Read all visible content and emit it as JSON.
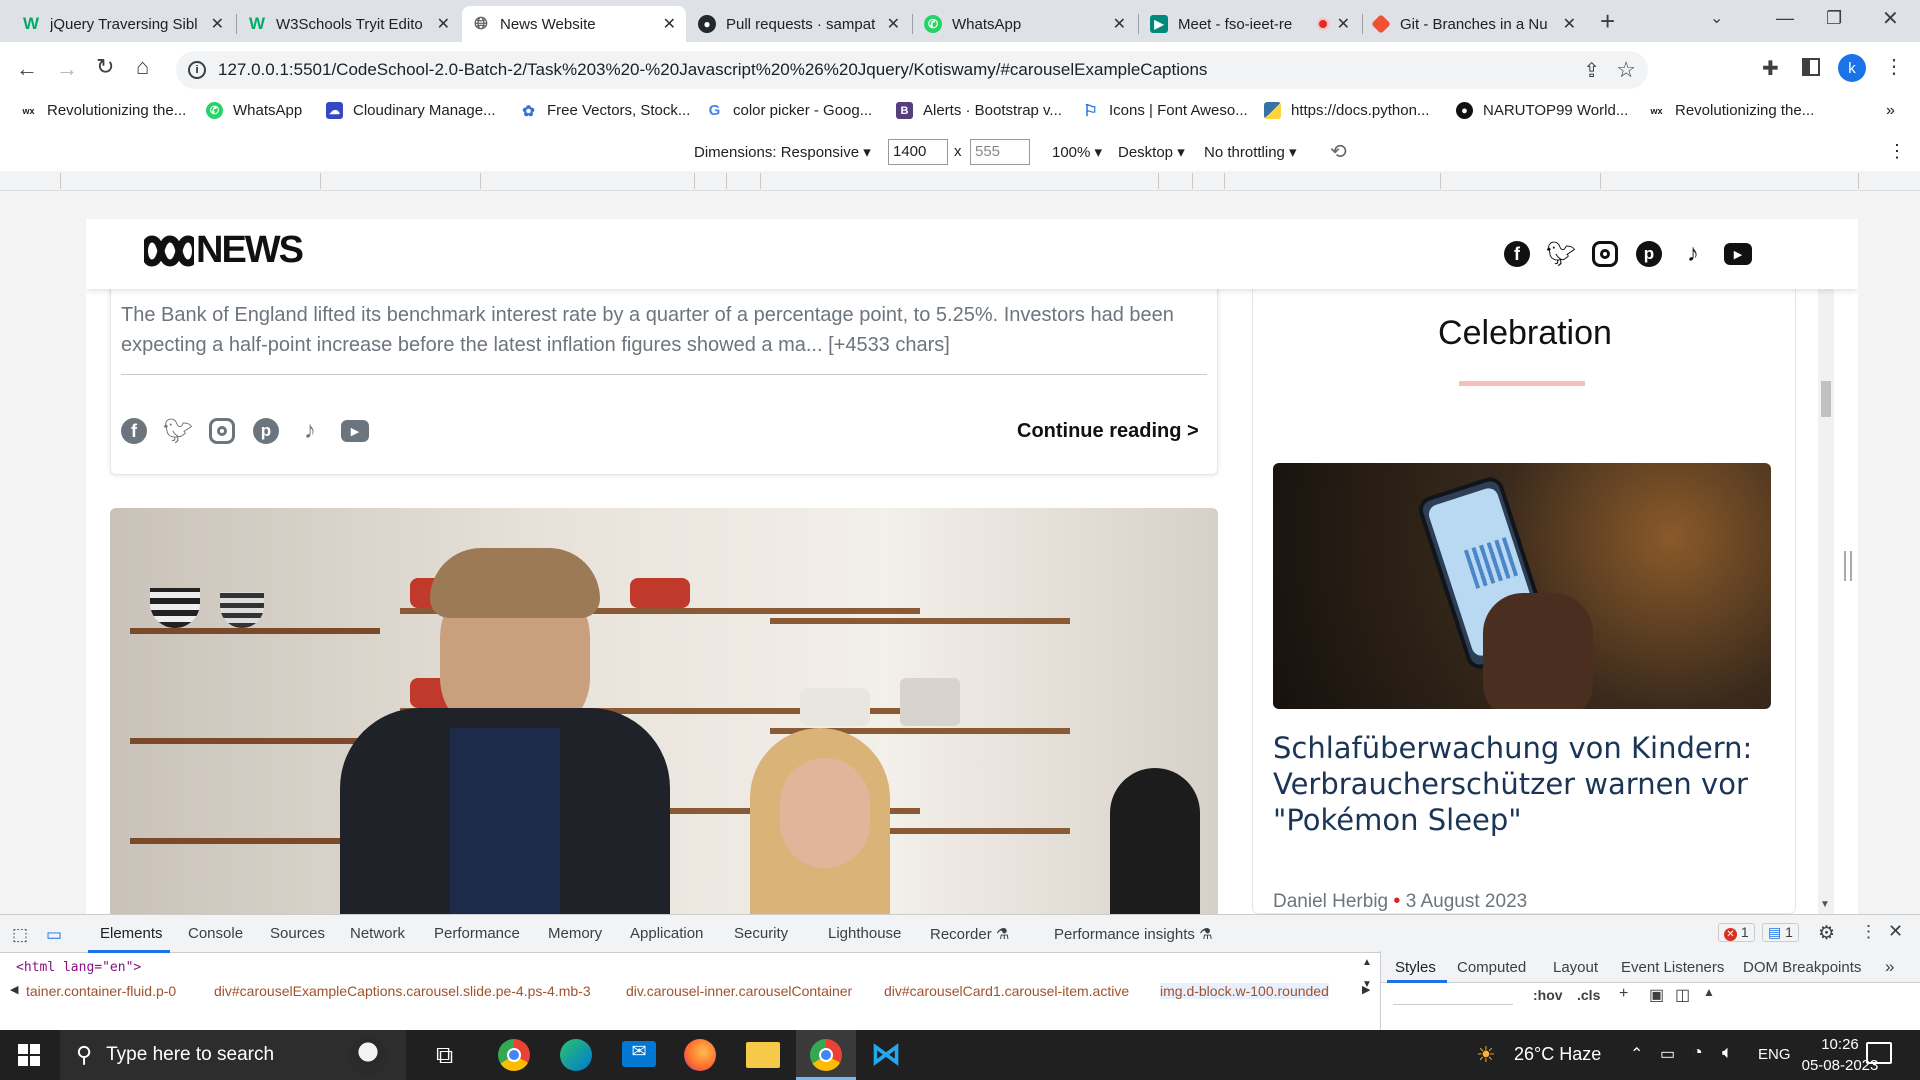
{
  "tabs": [
    {
      "title": "jQuery Traversing Sibl",
      "favicon": "w3schools-icon",
      "active": false
    },
    {
      "title": "W3Schools Tryit Edito",
      "favicon": "w3schools-icon",
      "active": false
    },
    {
      "title": "News Website",
      "favicon": "globe-icon",
      "active": true
    },
    {
      "title": "Pull requests · sampat",
      "favicon": "github-icon",
      "active": false
    },
    {
      "title": "WhatsApp",
      "favicon": "whatsapp-icon",
      "active": false
    },
    {
      "title": "Meet - fso-ieet-re",
      "favicon": "meet-icon",
      "active": false
    },
    {
      "title": "Git - Branches in a Nu",
      "favicon": "git-icon",
      "active": false
    }
  ],
  "address": {
    "url": "127.0.0.1:5501/CodeSchool-2.0-Batch-2/Task%203%20-%20Javascript%20%26%20Jquery/Kotiswamy/#carouselExampleCaptions",
    "profile_initial": "k"
  },
  "bookmarks": [
    {
      "label": "Revolutionizing the...",
      "icon": "wix-icon"
    },
    {
      "label": "WhatsApp",
      "icon": "whatsapp-icon"
    },
    {
      "label": "Cloudinary Manage...",
      "icon": "cloudinary-icon"
    },
    {
      "label": "Free Vectors, Stock...",
      "icon": "vecteezy-icon"
    },
    {
      "label": "color picker - Goog...",
      "icon": "google-icon"
    },
    {
      "label": "Alerts · Bootstrap v...",
      "icon": "bootstrap-icon"
    },
    {
      "label": "Icons | Font Aweso...",
      "icon": "flag-icon"
    },
    {
      "label": "https://docs.python...",
      "icon": "python-icon"
    },
    {
      "label": "NARUTOP99 World...",
      "icon": "github-icon"
    },
    {
      "label": "Revolutionizing the...",
      "icon": "wix-icon"
    }
  ],
  "device_toolbar": {
    "dimensions_label": "Dimensions: Responsive",
    "width": "1400",
    "height": "555",
    "zoom": "100%",
    "device": "Desktop",
    "throttle": "No throttling",
    "times": "x"
  },
  "site": {
    "logo": "NEWS",
    "article_excerpt": "The Bank of England lifted its benchmark interest rate by a quarter of a percentage point, to 5.25%. Investors had been expecting a half-point increase before the latest inflation figures showed a ma... [+4533 chars]",
    "continue_reading": "Continue reading",
    "sidebar_title": "Celebration",
    "sidebar_headline": "Schlafüberwachung von Kindern: Verbraucherschützer warnen vor \"Pokémon Sleep\"",
    "sidebar_author": "Daniel Herbig",
    "sidebar_date": "3 August 2023",
    "accent_color": "#f4c2b5",
    "date_dot_color": "#e02020"
  },
  "devtools": {
    "tabs": [
      "Elements",
      "Console",
      "Sources",
      "Network",
      "Performance",
      "Memory",
      "Application",
      "Security",
      "Lighthouse",
      "Recorder",
      "Performance insights"
    ],
    "error_count": "1",
    "message_count": "1",
    "html_line": "<html lang=\"en\">",
    "breadcrumbs": [
      "tainer.container-fluid.p-0",
      "div#carouselExampleCaptions.carousel.slide.pe-4.ps-4.mb-3",
      "div.carousel-inner.carouselContainer",
      "div#carouselCard1.carousel-item.active",
      "img.d-block.w-100.rounded"
    ],
    "side_tabs": [
      "Styles",
      "Computed",
      "Layout",
      "Event Listeners",
      "DOM Breakpoints"
    ],
    "styles_toolbar": [
      ":hov",
      ".cls"
    ]
  },
  "taskbar": {
    "search_placeholder": "Type here to search",
    "weather": "26°C Haze",
    "language": "ENG",
    "time": "10:26",
    "date": "05-08-2023"
  }
}
